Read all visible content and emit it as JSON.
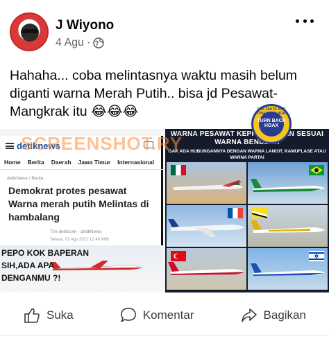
{
  "post": {
    "author": "J Wiyono",
    "date": "4 Agu",
    "dot": "·",
    "text": "Hahaha... coba melintasnya waktu masih belum diganti warna Merah Putih.. bisa jd Pesawat-Mangkrak itu 😂😂😂"
  },
  "icons": {
    "avatar": "avatar",
    "privacy": "globe-icon",
    "more": "more-options-icon",
    "like": "thumbs-up-icon",
    "comment": "comment-icon",
    "share": "share-icon"
  },
  "image": {
    "watermark": "SCREENSHOT.RY",
    "detik": {
      "logo": "detiknews",
      "nav": [
        "Home",
        "Berita",
        "Daerah",
        "Jawa Timur",
        "Internasional"
      ],
      "crumb": "detikNews / Berita",
      "headline": "Demokrat protes pesawat Warna merah putih Melintas di hambalang",
      "byline": "Tim detikcom - detikNews",
      "date": "Selasa, 03 Agu 2021 12:46 WIB"
    },
    "meme": "PEPO KOK BAPERAN SIH,ADA APA DENGANMU ?!",
    "right_title": "WARNA PESAWAT KEPRESIDENAN SESUAI WARNA BENDERA",
    "right_subtitle": "GAK ADA HUBUNGANNYA DENGAN WARNA LANGIT, KAMUFLASE ATAU WARNA PARTAI",
    "badge_text": "CEK FAKTA ANTI FITNAH DAN HOAX",
    "badge_center": "TURN BACK HOAX"
  },
  "actions": {
    "like": "Suka",
    "comment": "Komentar",
    "share": "Bagikan"
  },
  "colors": {
    "text": "#050505",
    "muted": "#65676b",
    "detik_blue": "#0c4da2",
    "panel_dark": "#151b2b"
  }
}
